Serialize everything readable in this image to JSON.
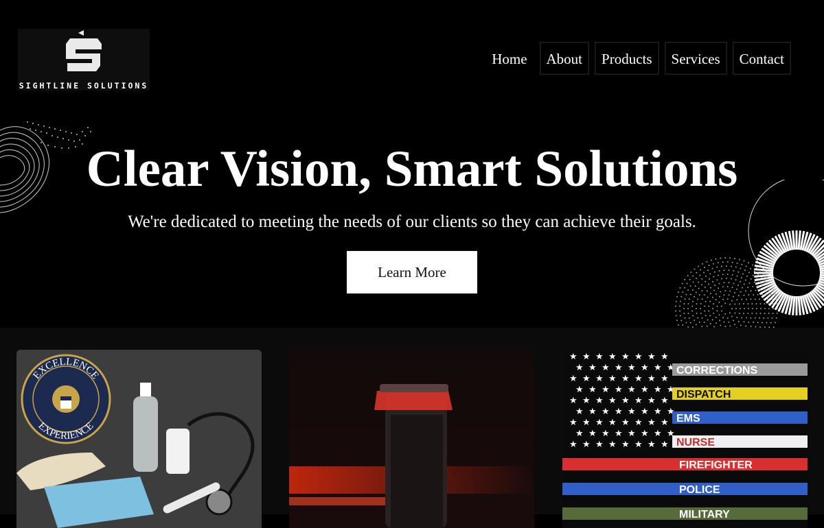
{
  "brand": {
    "name": "SIGHTLINE SOLUTIONS"
  },
  "nav": {
    "items": [
      "Home",
      "About",
      "Products",
      "Services",
      "Contact"
    ]
  },
  "hero": {
    "title": "Clear Vision, Smart Solutions",
    "subtitle": "We're dedicated to meeting the needs of our clients so they can achieve their goals.",
    "cta": "Learn More"
  },
  "cards": [
    {
      "seal_top": "EXCELLENCE",
      "seal_bottom": "EXPERIENCE"
    },
    {},
    {
      "labels": [
        "CORRECTIONS",
        "DISPATCH",
        "EMS",
        "NURSE",
        "FIREFIGHTER",
        "POLICE",
        "MILITARY"
      ]
    }
  ],
  "colors": {
    "background": "#000000",
    "cta_bg": "#ffffff",
    "cta_text": "#111111"
  }
}
